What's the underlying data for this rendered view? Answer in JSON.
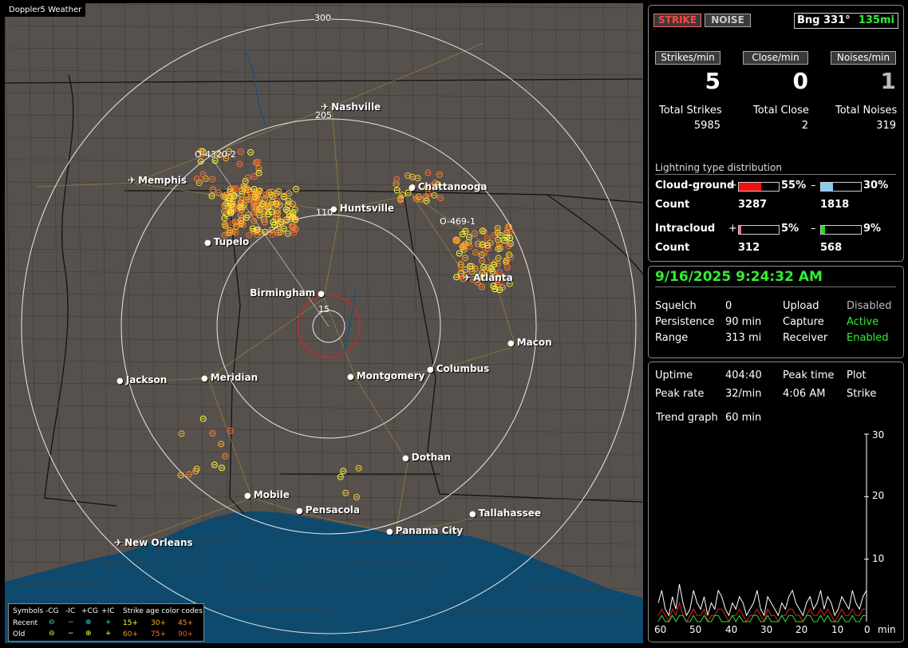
{
  "app_title": "Doppler5 Weather",
  "map": {
    "ring_labels": [
      "300",
      "205",
      "110",
      "15"
    ],
    "track_labels": [
      "O-4320-2",
      "O-469-1"
    ],
    "cities": [
      {
        "name": "Nashville",
        "icon": "airport-icon"
      },
      {
        "name": "Memphis",
        "icon": "airport-icon"
      },
      {
        "name": "Chattanooga",
        "icon": "city-dot-icon"
      },
      {
        "name": "Huntsville",
        "icon": "city-dot-icon"
      },
      {
        "name": "Tupelo",
        "icon": "city-dot-icon"
      },
      {
        "name": "Atlanta",
        "icon": "airport-icon"
      },
      {
        "name": "Birmingham",
        "icon": "city-dot-icon"
      },
      {
        "name": "Macon",
        "icon": "city-dot-icon"
      },
      {
        "name": "Jackson",
        "icon": "city-dot-icon"
      },
      {
        "name": "Meridian",
        "icon": "city-dot-icon"
      },
      {
        "name": "Montgomery",
        "icon": "city-dot-icon"
      },
      {
        "name": "Columbus",
        "icon": "city-dot-icon"
      },
      {
        "name": "Dothan",
        "icon": "city-dot-icon"
      },
      {
        "name": "Mobile",
        "icon": "city-dot-icon"
      },
      {
        "name": "Pensacola",
        "icon": "city-dot-icon"
      },
      {
        "name": "Tallahassee",
        "icon": "city-dot-icon"
      },
      {
        "name": "Panama City",
        "icon": "city-dot-icon"
      },
      {
        "name": "New Orleans",
        "icon": "airport-icon"
      }
    ],
    "legend": {
      "symbols_label": "Symbols",
      "types": [
        "-CG",
        "-IC",
        "+CG",
        "+IC"
      ],
      "age_title": "Strike age color codes",
      "recent_label": "Recent",
      "old_label": "Old",
      "recent_ages": [
        "15+",
        "30+",
        "45+"
      ],
      "old_ages": [
        "60+",
        "75+",
        "90+"
      ]
    }
  },
  "stats": {
    "strike_button": "STRIKE",
    "noise_button": "NOISE",
    "bearing_label": "Bng 331°",
    "bearing_range": "135mi",
    "rate_labels": [
      "Strikes/min",
      "Close/min",
      "Noises/min"
    ],
    "rate_values": [
      "5",
      "0",
      "1"
    ],
    "total_labels": [
      "Total Strikes",
      "Total Close",
      "Total Noises"
    ],
    "total_values": [
      "5985",
      "2",
      "319"
    ],
    "dist_title": "Lightning type distribution",
    "cg_label": "Cloud-ground",
    "ic_label": "Intracloud",
    "count_label": "Count",
    "plus": "+",
    "minus": "–",
    "cg_pos_pct": "55%",
    "cg_neg_pct": "30%",
    "cg_pos_count": "3287",
    "cg_neg_count": "1818",
    "ic_pos_pct": "5%",
    "ic_neg_pct": "9%",
    "ic_pos_count": "312",
    "ic_neg_count": "568",
    "cg_pos_frac": 0.55,
    "cg_neg_frac": 0.3,
    "ic_pos_frac": 0.05,
    "ic_neg_frac": 0.09
  },
  "status": {
    "datetime": "9/16/2025 9:24:32 AM",
    "squelch_label": "Squelch",
    "squelch_value": "0",
    "persistence_label": "Persistence",
    "persistence_value": "90 min",
    "range_label": "Range",
    "range_value": "313 mi",
    "upload_label": "Upload",
    "upload_value": "Disabled",
    "capture_label": "Capture",
    "capture_value": "Active",
    "receiver_label": "Receiver",
    "receiver_value": "Enabled"
  },
  "trend": {
    "uptime_label": "Uptime",
    "uptime_value": "404:40",
    "peak_time_label": "Peak time",
    "plot_label": "Plot",
    "peak_rate_label": "Peak rate",
    "peak_rate_value": "32/min",
    "peak_time_value": "4:06 AM",
    "plot_value": "Strike",
    "trend_graph_label": "Trend graph",
    "trend_graph_value": "60 min",
    "y_ticks": [
      "30",
      "20",
      "10"
    ],
    "x_ticks": [
      "60",
      "50",
      "40",
      "30",
      "20",
      "10",
      "0"
    ],
    "x_unit": "min"
  },
  "chart_data": {
    "type": "line",
    "xlabel": "min",
    "ylim": [
      0,
      30
    ],
    "xlim": [
      60,
      0
    ],
    "series": [
      {
        "color": "#ffffff",
        "values": [
          3,
          5,
          2,
          1,
          4,
          2,
          6,
          3,
          1,
          2,
          5,
          3,
          2,
          4,
          1,
          3,
          2,
          5,
          4,
          2,
          1,
          3,
          2,
          4,
          3,
          1,
          2,
          3,
          5,
          2,
          1,
          4,
          3,
          2,
          1,
          3,
          2,
          4,
          5,
          3,
          2,
          1,
          3,
          4,
          2,
          3,
          5,
          2,
          4,
          3,
          1,
          2,
          4,
          3,
          2,
          5,
          3,
          2,
          4,
          5
        ]
      },
      {
        "color": "#dd2222",
        "values": [
          1,
          2,
          1,
          0,
          2,
          1,
          3,
          1,
          0,
          1,
          2,
          1,
          1,
          2,
          0,
          1,
          1,
          2,
          2,
          1,
          0,
          1,
          1,
          2,
          1,
          0,
          1,
          1,
          2,
          1,
          0,
          2,
          1,
          1,
          0,
          1,
          1,
          2,
          2,
          1,
          1,
          0,
          1,
          2,
          1,
          1,
          2,
          1,
          2,
          1,
          0,
          1,
          2,
          1,
          1,
          2,
          1,
          1,
          2,
          2
        ]
      },
      {
        "color": "#33dd33",
        "values": [
          0,
          1,
          0,
          0,
          1,
          0,
          1,
          1,
          0,
          0,
          1,
          0,
          0,
          1,
          0,
          0,
          1,
          1,
          0,
          0,
          0,
          1,
          0,
          1,
          0,
          0,
          0,
          1,
          1,
          0,
          0,
          1,
          0,
          0,
          0,
          1,
          0,
          1,
          1,
          0,
          0,
          0,
          1,
          1,
          0,
          0,
          1,
          0,
          1,
          0,
          0,
          0,
          1,
          0,
          0,
          1,
          0,
          0,
          1,
          1
        ]
      }
    ]
  }
}
